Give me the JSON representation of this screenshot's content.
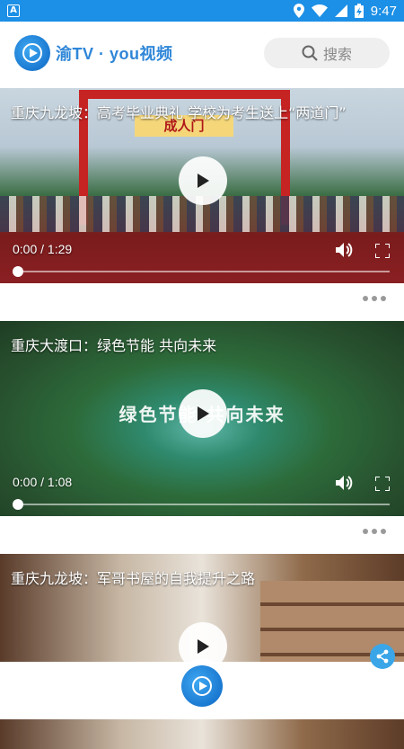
{
  "status_bar": {
    "time": "9:47"
  },
  "header": {
    "brand": "渝TV · you视频",
    "search_label": "搜索"
  },
  "feed": {
    "items": [
      {
        "title": "重庆九龙坡：高考毕业典礼 学校为考生送上“两道门”",
        "scene_text": "成人门",
        "time": "0:00 / 1:29",
        "progress": 0
      },
      {
        "title": "重庆大渡口：绿色节能 共向未来",
        "scene_text": "绿色节能 共向未来",
        "time": "0:00 / 1:08",
        "progress": 0
      },
      {
        "title": "重庆九龙坡：军哥书屋的自我提升之路"
      }
    ]
  },
  "colors": {
    "accent": "#1c8fe6",
    "brand": "#2f86d8"
  }
}
